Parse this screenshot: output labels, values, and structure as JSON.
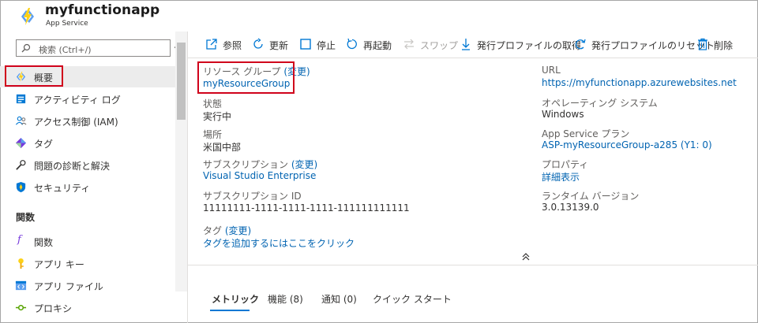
{
  "header": {
    "title": "myfunctionapp",
    "subtitle": "App Service"
  },
  "sidebar": {
    "search_placeholder": "検索 (Ctrl+/)",
    "collapse_glyph": "«",
    "items": [
      {
        "label": "概要",
        "icon": "function-app-icon"
      },
      {
        "label": "アクティビティ ログ",
        "icon": "activity-log-icon"
      },
      {
        "label": "アクセス制御 (IAM)",
        "icon": "iam-icon"
      },
      {
        "label": "タグ",
        "icon": "tag-icon"
      },
      {
        "label": "問題の診断と解決",
        "icon": "wrench-icon"
      },
      {
        "label": "セキュリティ",
        "icon": "shield-icon"
      }
    ],
    "section_functions": "関数",
    "function_items": [
      {
        "label": "関数",
        "icon": "function-icon"
      },
      {
        "label": "アプリ キー",
        "icon": "key-icon"
      },
      {
        "label": "アプリ ファイル",
        "icon": "code-file-icon"
      },
      {
        "label": "プロキシ",
        "icon": "proxy-icon"
      }
    ]
  },
  "toolbar": {
    "browse": "参照",
    "refresh": "更新",
    "stop": "停止",
    "restart": "再起動",
    "swap": "スワップ",
    "get_profile": "発行プロファイルの取得",
    "reset_profile": "発行プロファイルのリセット",
    "delete": "削除"
  },
  "essentials": {
    "resource_group_label": "リソース グループ",
    "change": "(変更)",
    "resource_group": "myResourceGroup",
    "status_label": "状態",
    "status": "実行中",
    "location_label": "場所",
    "location": "米国中部",
    "subscription_label": "サブスクリプション",
    "subscription": "Visual Studio Enterprise",
    "subscription_id_label": "サブスクリプション ID",
    "subscription_id": "11111111-1111-1111-1111-111111111111",
    "tags_label": "タグ",
    "tags_link": "タグを追加するにはここをクリック",
    "url_label": "URL",
    "url": "https://myfunctionapp.azurewebsites.net",
    "os_label": "オペレーティング システム",
    "os": "Windows",
    "plan_label": "App Service プラン",
    "plan": "ASP-myResourceGroup-a285 (Y1: 0)",
    "properties_label": "プロパティ",
    "properties_link": "詳細表示",
    "runtime_label": "ランタイム バージョン",
    "runtime": "3.0.13139.0"
  },
  "tabs": [
    "メトリック",
    "機能 (8)",
    "通知 (0)",
    "クイック スタート"
  ],
  "colors": {
    "accent": "#0078d4",
    "link": "#0063b1",
    "highlight": "#d0021b"
  }
}
